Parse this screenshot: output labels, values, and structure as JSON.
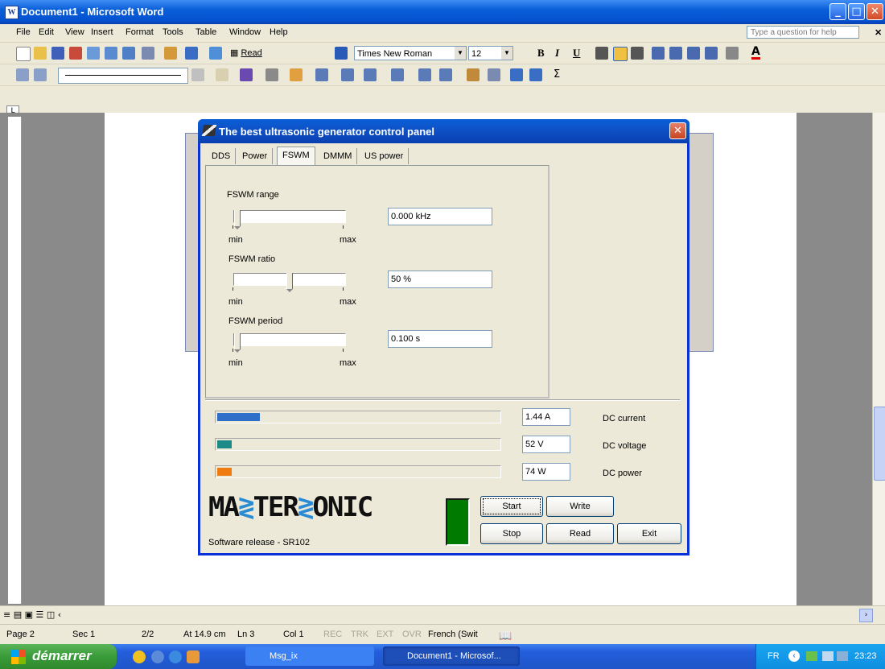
{
  "word": {
    "window_title": "Document1 - Microsoft Word",
    "menu": [
      "File",
      "Edit",
      "View",
      "Insert",
      "Format",
      "Tools",
      "Table",
      "Window",
      "Help"
    ],
    "ask_placeholder": "Type a question for help",
    "toolbar": {
      "read_label": "Read",
      "font_name": "Times New Roman",
      "font_size": "12"
    },
    "status": {
      "page": "Page 2",
      "sec": "Sec 1",
      "pages": "2/2",
      "at": "At 14.9 cm",
      "ln": "Ln 3",
      "col": "Col 1",
      "rec": "REC",
      "trk": "TRK",
      "ext": "EXT",
      "ovr": "OVR",
      "lang": "French (Swit"
    }
  },
  "dialog": {
    "title": "The best ultrasonic generator control panel",
    "tabs": [
      "DDS",
      "Power",
      "FSWM",
      "DMMM",
      "US power"
    ],
    "active_tab": "FSWM",
    "sliders": [
      {
        "label": "FSWM range",
        "value_text": "0.000 kHz",
        "min_label": "min",
        "max_label": "max",
        "position": 0.0
      },
      {
        "label": "FSWM ratio",
        "value_text": "50 %",
        "min_label": "min",
        "max_label": "max",
        "position": 0.5
      },
      {
        "label": "FSWM period",
        "value_text": "0.100 s",
        "min_label": "min",
        "max_label": "max",
        "position": 0.0
      }
    ],
    "meters": [
      {
        "value": "1.44 A",
        "label": "DC current",
        "color": "#2f6fc9",
        "fraction": 0.15
      },
      {
        "value": "52 V",
        "label": "DC voltage",
        "color": "#1d8a8a",
        "fraction": 0.05
      },
      {
        "value": "74 W",
        "label": "DC power",
        "color": "#f07b10",
        "fraction": 0.05
      }
    ],
    "logo_text": "MASTERSONIC",
    "software_release": "Software release - SR102",
    "buttons": {
      "start": "Start",
      "write": "Write",
      "stop": "Stop",
      "read": "Read",
      "exit": "Exit"
    },
    "led_color": "#007a00"
  },
  "taskbar": {
    "start_label": "démarrer",
    "tasks": [
      "Msg_ix",
      "Document1 - Microsof..."
    ],
    "lang": "FR",
    "clock": "23:23"
  }
}
